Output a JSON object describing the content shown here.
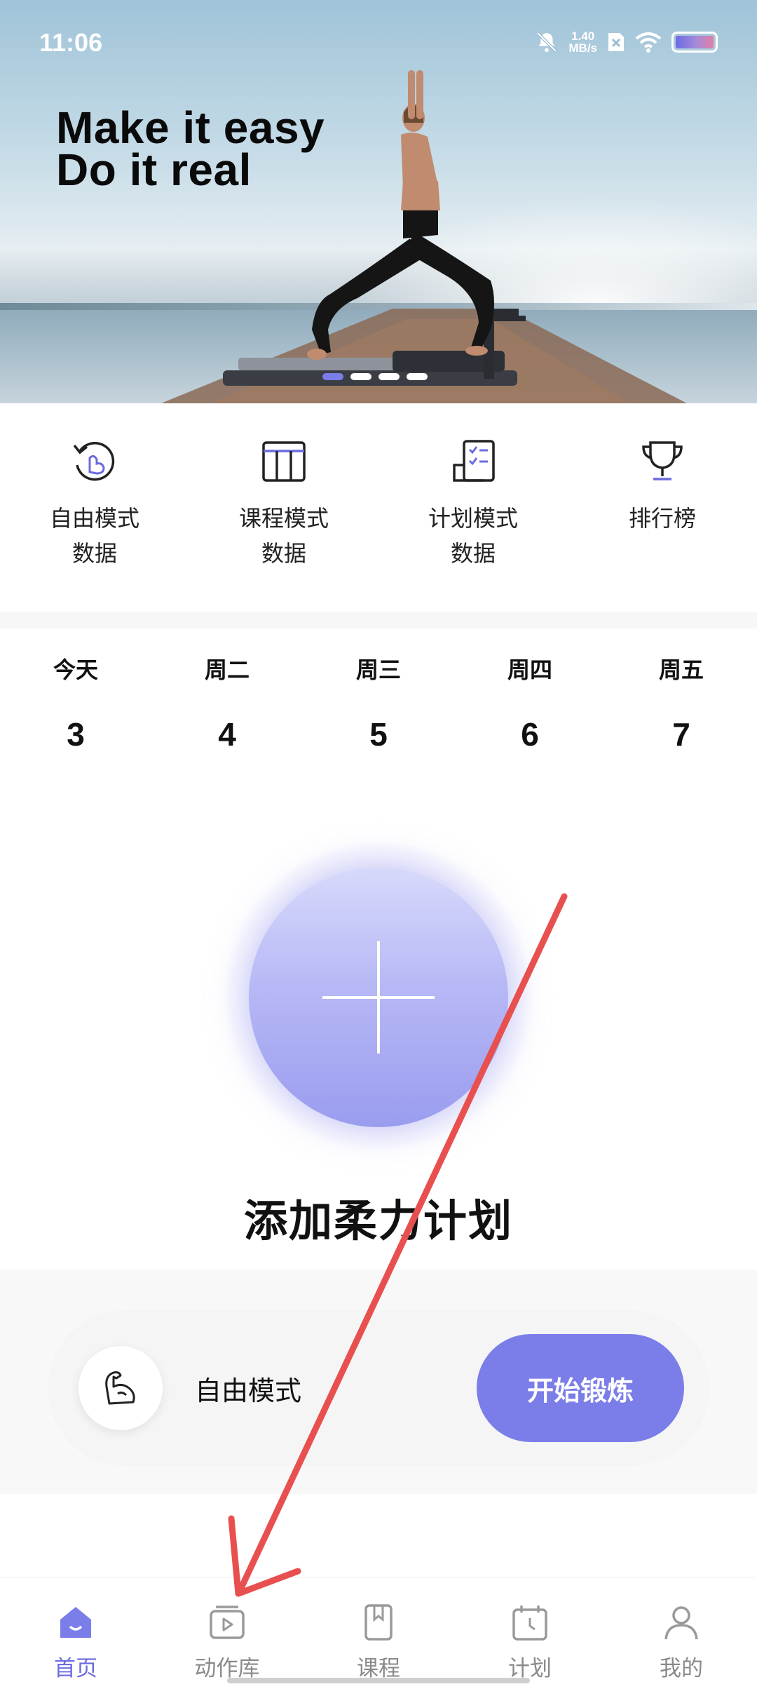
{
  "status_bar": {
    "time": "11:06",
    "speed_value": "1.40",
    "speed_unit": "MB/s",
    "icons": [
      "bell-muted-icon",
      "sim-x-icon",
      "wifi-icon",
      "battery-icon"
    ]
  },
  "hero": {
    "line1": "Make it easy",
    "line2": "Do it real"
  },
  "quick_menu": [
    {
      "line1": "自由模式",
      "line2": "数据",
      "icon": "rotate-arm-icon"
    },
    {
      "line1": "课程模式",
      "line2": "数据",
      "icon": "grid-icon"
    },
    {
      "line1": "计划模式",
      "line2": "数据",
      "icon": "checklist-icon"
    },
    {
      "line1": "排行榜",
      "line2": "",
      "icon": "trophy-icon"
    }
  ],
  "dates": [
    {
      "day": "今天",
      "num": "3"
    },
    {
      "day": "周二",
      "num": "4"
    },
    {
      "day": "周三",
      "num": "5"
    },
    {
      "day": "周四",
      "num": "6"
    },
    {
      "day": "周五",
      "num": "7"
    }
  ],
  "add_plan": {
    "title": "添加柔力计划"
  },
  "free_mode": {
    "label": "自由模式",
    "button": "开始锻炼",
    "icon": "flexed-arm-icon"
  },
  "bottom_nav": [
    {
      "label": "首页",
      "icon": "home-icon",
      "active": true
    },
    {
      "label": "动作库",
      "icon": "video-library-icon",
      "active": false
    },
    {
      "label": "课程",
      "icon": "bookmark-book-icon",
      "active": false
    },
    {
      "label": "计划",
      "icon": "calendar-clock-icon",
      "active": false
    },
    {
      "label": "我的",
      "icon": "person-icon",
      "active": false
    }
  ],
  "colors": {
    "accent": "#7b7de8",
    "nav_active": "#6c6be0",
    "annotation": "#e8504f"
  }
}
